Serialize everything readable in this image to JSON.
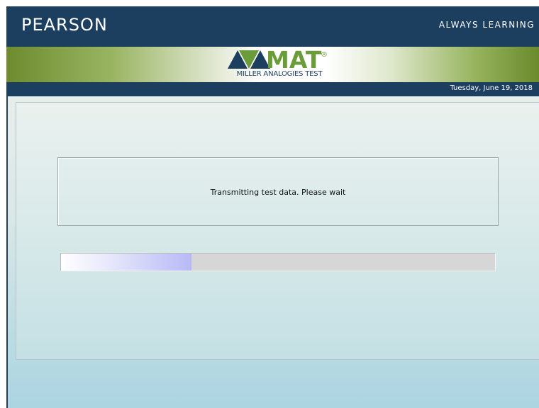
{
  "header": {
    "brand": "PEARSON",
    "tagline": "ALWAYS LEARNING"
  },
  "banner": {
    "logo_text": "MAT",
    "registered_mark": "®",
    "subtitle": "MILLER ANALOGIES TEST"
  },
  "date_bar": {
    "date": "Tuesday, June 19, 2018"
  },
  "main": {
    "message": "Transmitting test data.  Please wait",
    "progress_fraction": 0.3
  },
  "colors": {
    "navy": "#1c3e5f",
    "green": "#6b9c3a",
    "progress_fill": "#b8b9f6"
  }
}
